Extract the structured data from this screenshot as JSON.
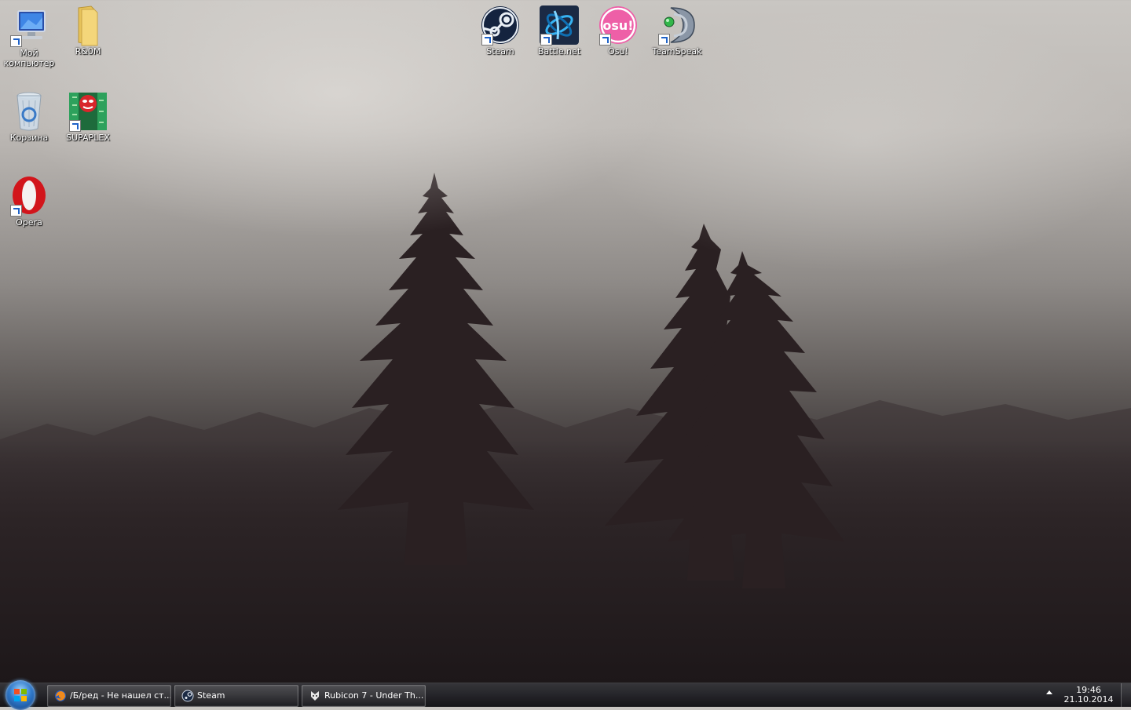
{
  "desktop": {
    "icons": [
      {
        "label": "Мой\nкомпьютер",
        "icon": "computer-icon"
      },
      {
        "label": "R&0M",
        "icon": "folder-icon"
      },
      {
        "label": "Корзина",
        "icon": "recycle-bin-icon"
      },
      {
        "label": "SUPAPLEX",
        "icon": "supaplex-icon"
      },
      {
        "label": "Opera",
        "icon": "opera-icon"
      },
      {
        "label": "Steam",
        "icon": "steam-icon"
      },
      {
        "label": "Battle.net",
        "icon": "battlenet-icon"
      },
      {
        "label": "Osu!",
        "icon": "osu-icon"
      },
      {
        "label": "TeamSpeak",
        "icon": "teamspeak-icon"
      }
    ],
    "osu_logo_text": "osu!"
  },
  "taskbar": {
    "buttons": [
      {
        "label": "/Б/ред - Не нашел ст...",
        "icon": "firefox-icon"
      },
      {
        "label": "Steam",
        "icon": "steam-icon"
      },
      {
        "label": "Rubicon 7 - Under Th...",
        "icon": "app-icon"
      }
    ],
    "clock": {
      "time": "19:46",
      "date": "21.10.2014"
    }
  },
  "colors": {
    "opera_red": "#d2151b",
    "osu_pink": "#ee5fa7",
    "steam_navy": "#14233f",
    "battlenet_blue": "#0f6fb2"
  }
}
